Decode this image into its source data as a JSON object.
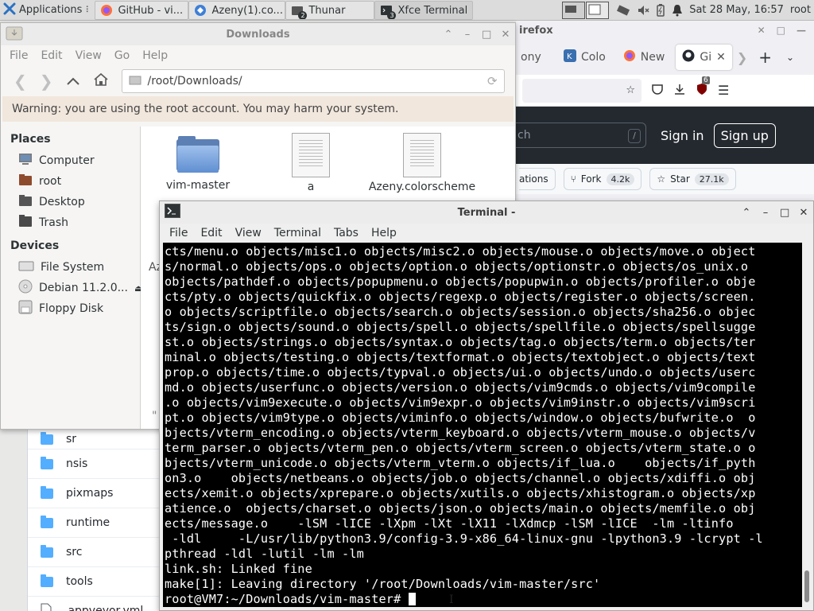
{
  "panel": {
    "applications_label": "Applications",
    "tasks": [
      {
        "label": "GitHub - vi...",
        "icon": "firefox-icon",
        "active": false,
        "badge": ""
      },
      {
        "label": "Azeny(1).co...",
        "icon": "browser-icon",
        "active": false,
        "badge": ""
      },
      {
        "label": "Thunar",
        "icon": "thunar-icon",
        "active": false,
        "badge": "2"
      },
      {
        "label": "Xfce Terminal",
        "icon": "terminal-icon",
        "active": true,
        "badge": "3"
      }
    ],
    "clock": "Sat 28 May, 16:57",
    "user": "root"
  },
  "firefox": {
    "title": "irefox",
    "tabs": [
      {
        "label": "ony"
      },
      {
        "label": "Colo"
      },
      {
        "label": "New"
      },
      {
        "label": "Gi"
      }
    ],
    "downloads_badge": "6",
    "search_placeholder": "ch",
    "search_shortcut": "/",
    "sign_in": "Sign in",
    "sign_up": "Sign up",
    "notifications_label": "ations",
    "fork_label": "Fork",
    "fork_count": "4.2k",
    "star_label": "Star",
    "star_count": "27.1k"
  },
  "github_files": [
    {
      "name": "sr"
    },
    {
      "name": "nsis"
    },
    {
      "name": "pixmaps"
    },
    {
      "name": "runtime"
    },
    {
      "name": "src"
    },
    {
      "name": "tools"
    },
    {
      "name": ".appveyor.yml"
    }
  ],
  "thunar": {
    "title": "Downloads",
    "menu": [
      "File",
      "Edit",
      "View",
      "Go",
      "Help"
    ],
    "location": "/root/Downloads/",
    "warning": "Warning: you are using the root account. You may harm your system.",
    "places_heading": "Places",
    "places": [
      {
        "label": "Computer",
        "icon": "computer-icon"
      },
      {
        "label": "root",
        "icon": "home-folder-icon"
      },
      {
        "label": "Desktop",
        "icon": "desktop-icon"
      },
      {
        "label": "Trash",
        "icon": "trash-icon"
      }
    ],
    "devices_heading": "Devices",
    "devices": [
      {
        "label": "File System",
        "icon": "drive-icon"
      },
      {
        "label": "Debian 11.2.0...",
        "icon": "optical-disc-icon"
      },
      {
        "label": "Floppy Disk",
        "icon": "floppy-icon"
      }
    ],
    "files": [
      {
        "name": "vim-master",
        "type": "folder"
      },
      {
        "name": "a",
        "type": "document"
      },
      {
        "name": "Azeny.colorscheme",
        "type": "document"
      }
    ],
    "partial_label": "Az",
    "partial_label_2": "\""
  },
  "terminal": {
    "title": "Terminal -",
    "menu": [
      "File",
      "Edit",
      "View",
      "Terminal",
      "Tabs",
      "Help"
    ],
    "lines": [
      "cts/menu.o objects/misc1.o objects/misc2.o objects/mouse.o objects/move.o object",
      "s/normal.o objects/ops.o objects/option.o objects/optionstr.o objects/os_unix.o ",
      "objects/pathdef.o objects/popupmenu.o objects/popupwin.o objects/profiler.o obje",
      "cts/pty.o objects/quickfix.o objects/regexp.o objects/register.o objects/screen.",
      "o objects/scriptfile.o objects/search.o objects/session.o objects/sha256.o objec",
      "ts/sign.o objects/sound.o objects/spell.o objects/spellfile.o objects/spellsugge",
      "st.o objects/strings.o objects/syntax.o objects/tag.o objects/term.o objects/ter",
      "minal.o objects/testing.o objects/textformat.o objects/textobject.o objects/text",
      "prop.o objects/time.o objects/typval.o objects/ui.o objects/undo.o objects/userc",
      "md.o objects/userfunc.o objects/version.o objects/vim9cmds.o objects/vim9compile",
      ".o objects/vim9execute.o objects/vim9expr.o objects/vim9instr.o objects/vim9scri",
      "pt.o objects/vim9type.o objects/viminfo.o objects/window.o objects/bufwrite.o  o",
      "bjects/vterm_encoding.o objects/vterm_keyboard.o objects/vterm_mouse.o objects/v",
      "term_parser.o objects/vterm_pen.o objects/vterm_screen.o objects/vterm_state.o o",
      "bjects/vterm_unicode.o objects/vterm_vterm.o objects/if_lua.o    objects/if_pyth",
      "on3.o    objects/netbeans.o objects/job.o objects/channel.o objects/xdiffi.o obj",
      "ects/xemit.o objects/xprepare.o objects/xutils.o objects/xhistogram.o objects/xp",
      "atience.o  objects/charset.o objects/json.o objects/main.o objects/memfile.o obj",
      "ects/message.o    -lSM -lICE -lXpm -lXt -lX11 -lXdmcp -lSM -lICE  -lm -ltinfo  ",
      " -ldl     -L/usr/lib/python3.9/config-3.9-x86_64-linux-gnu -lpython3.9 -lcrypt -l",
      "pthread -ldl -lutil -lm -lm",
      "link.sh: Linked fine",
      "make[1]: Leaving directory '/root/Downloads/vim-master/src'"
    ],
    "prompt": "root@VM7:~/Downloads/vim-master# "
  }
}
